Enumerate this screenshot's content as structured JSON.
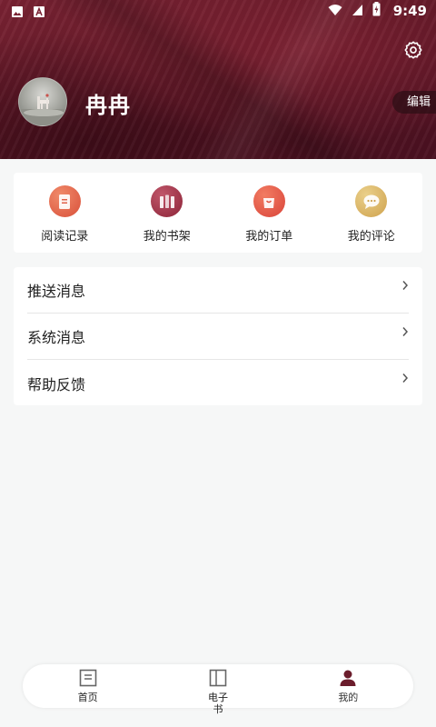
{
  "status_bar": {
    "time": "9:49",
    "left_icons": [
      "image-icon",
      "text-a-icon"
    ],
    "right_icons": [
      "wifi-icon",
      "cell-signal-icon",
      "battery-icon"
    ]
  },
  "profile": {
    "username": "冉冉",
    "edit_label": "编辑",
    "settings_icon": "gear-icon",
    "avatar": "avatar-image"
  },
  "quick_actions": [
    {
      "label": "阅读记录",
      "icon": "reading-record-icon",
      "color": "#e46a4c"
    },
    {
      "label": "我的书架",
      "icon": "bookshelf-icon",
      "color": "#a3354b"
    },
    {
      "label": "我的订单",
      "icon": "order-icon",
      "color": "#e85a45"
    },
    {
      "label": "我的评论",
      "icon": "comment-icon",
      "color": "#d8b060"
    }
  ],
  "menu": [
    {
      "label": "推送消息"
    },
    {
      "label": "系统消息"
    },
    {
      "label": "帮助反馈"
    }
  ],
  "bottom_nav": [
    {
      "label": "首页",
      "icon": "home-icon",
      "active": false
    },
    {
      "label": "电子书",
      "icon": "book-icon",
      "active": false
    },
    {
      "label": "我的",
      "icon": "person-icon",
      "active": true
    }
  ],
  "colors": {
    "brand": "#6b1d2c",
    "background": "#f6f7f7",
    "active_nav": "#6b1d2c"
  }
}
